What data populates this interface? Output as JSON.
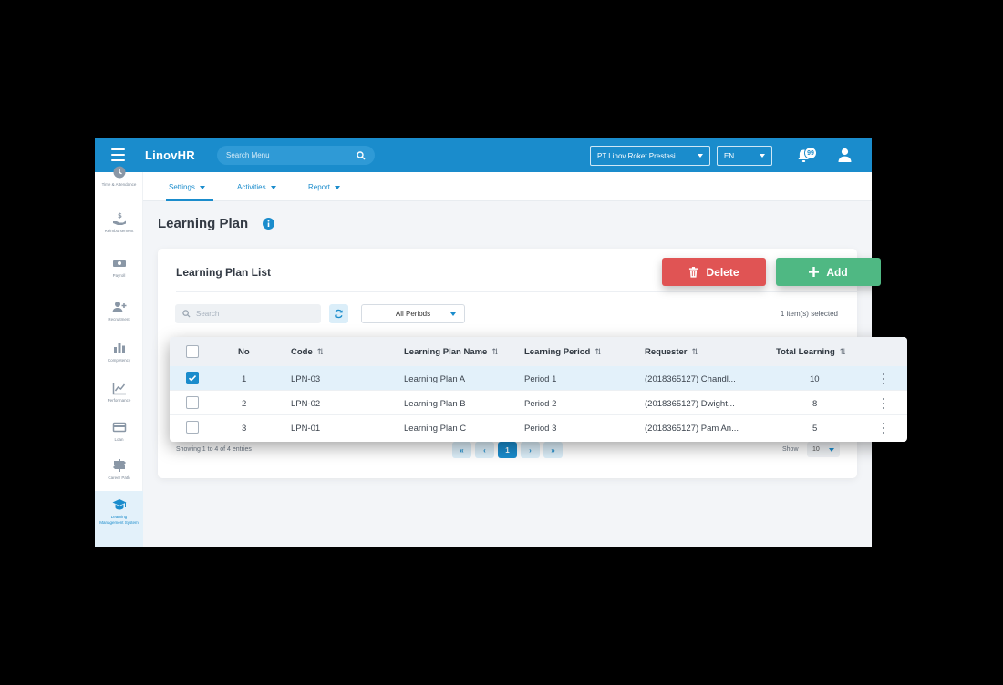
{
  "app": {
    "logo": "LinovHR"
  },
  "topbar": {
    "search_placeholder": "Search Menu",
    "company": "PT Linov Roket Prestasi",
    "language": "EN",
    "notification_count": "99"
  },
  "sidebar": {
    "items": [
      {
        "label": "Time & Attendance",
        "icon": "clock-icon"
      },
      {
        "label": "Reimbursement",
        "icon": "money-hand-icon"
      },
      {
        "label": "Payroll",
        "icon": "banknote-icon"
      },
      {
        "label": "Recruitment",
        "icon": "user-plus-icon"
      },
      {
        "label": "Competency",
        "icon": "bar-chart-icon"
      },
      {
        "label": "Performance",
        "icon": "trend-chart-icon"
      },
      {
        "label": "Loan",
        "icon": "card-icon"
      },
      {
        "label": "Career Path",
        "icon": "signpost-icon"
      },
      {
        "label": "Learning Management System",
        "icon": "graduation-cap-icon"
      }
    ]
  },
  "subnav": {
    "items": [
      "Settings",
      "Activities",
      "Report"
    ]
  },
  "page": {
    "title": "Learning Plan"
  },
  "card": {
    "title": "Learning Plan List",
    "search_placeholder": "Search",
    "period_filter": "All Periods",
    "selected_count": "1 item(s) selected",
    "showing": "Showing 1 to 4 of 4 entries",
    "show_label": "Show",
    "page_size": "10",
    "current_page": "1"
  },
  "actions": {
    "delete": "Delete",
    "add": "Add"
  },
  "table": {
    "headers": [
      "No",
      "Code",
      "Learning Plan Name",
      "Learning Period",
      "Requester",
      "Total Learning"
    ],
    "rows": [
      {
        "no": "1",
        "code": "LPN-03",
        "name": "Learning Plan A",
        "period": "Period 1",
        "requester": "(2018365127) Chandl...",
        "total": "10",
        "checked": true
      },
      {
        "no": "2",
        "code": "LPN-02",
        "name": "Learning Plan B",
        "period": "Period 2",
        "requester": "(2018365127) Dwight...",
        "total": "8",
        "checked": false
      },
      {
        "no": "3",
        "code": "LPN-01",
        "name": "Learning Plan C",
        "period": "Period 3",
        "requester": "(2018365127) Pam An...",
        "total": "5",
        "checked": false
      }
    ]
  },
  "colors": {
    "primary": "#1a8ccc",
    "delete": "#e05454",
    "add": "#4fb883"
  }
}
